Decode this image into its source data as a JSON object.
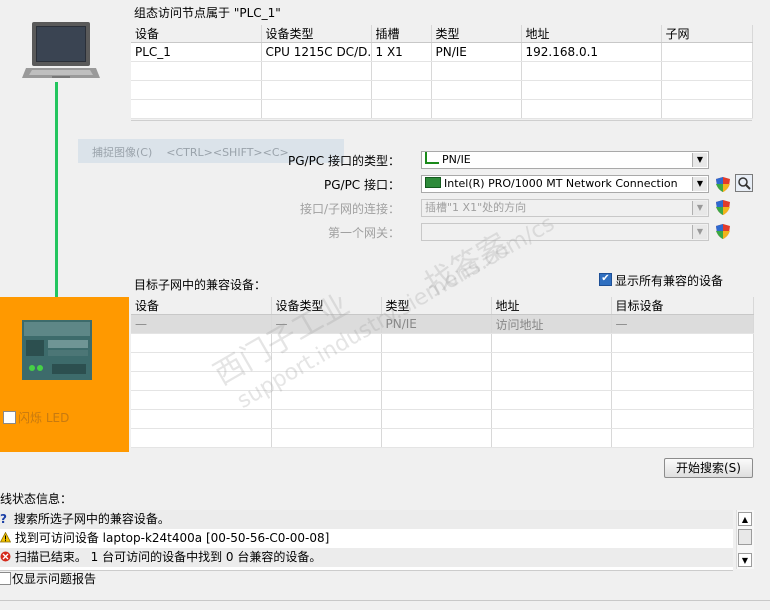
{
  "access_table": {
    "caption": "组态访问节点属于 \"PLC_1\"",
    "headers": [
      "设备",
      "设备类型",
      "插槽",
      "类型",
      "地址",
      "子网"
    ],
    "rows": [
      [
        "PLC_1",
        "CPU 1215C DC/D...",
        "1 X1",
        "PN/IE",
        "192.168.0.1",
        ""
      ],
      [
        "",
        "",
        "",
        "",
        "",
        ""
      ],
      [
        "",
        "",
        "",
        "",
        "",
        ""
      ],
      [
        "",
        "",
        "",
        "",
        "",
        ""
      ]
    ]
  },
  "capture_hint": "捕捉图像(C)    <CTRL><SHIFT><C>",
  "form": {
    "pgpc_type_label": "PG/PC 接口的类型：",
    "pgpc_type_value": "PN/IE",
    "pgpc_interface_label": "PG/PC 接口：",
    "pgpc_interface_value": "Intel(R) PRO/1000 MT Network Connection",
    "subnet_conn_label": "接口/子网的连接：",
    "subnet_conn_value": "插槽\"1 X1\"处的方向",
    "gateway_label": "第一个网关：",
    "gateway_value": ""
  },
  "compatible": {
    "caption": "目标子网中的兼容设备：",
    "show_all_label": "显示所有兼容的设备",
    "show_all_checked": true,
    "headers": [
      "设备",
      "设备类型",
      "类型",
      "地址",
      "目标设备"
    ],
    "rows": [
      [
        "—",
        "—",
        "PN/IE",
        "访问地址",
        "—"
      ],
      [
        "",
        "",
        "",
        "",
        ""
      ],
      [
        "",
        "",
        "",
        "",
        ""
      ],
      [
        "",
        "",
        "",
        "",
        ""
      ],
      [
        "",
        "",
        "",
        "",
        ""
      ],
      [
        "",
        "",
        "",
        "",
        ""
      ],
      [
        "",
        "",
        "",
        "",
        ""
      ]
    ]
  },
  "flash_led_label": "闪烁 LED",
  "start_search_label": "开始搜索(S)",
  "status": {
    "caption": "在线状态信息：",
    "messages": [
      {
        "icon": "question-icon",
        "text": "搜索所选子网中的兼容设备。"
      },
      {
        "icon": "warning-icon",
        "text": "找到可访问设备 laptop-k24t400a [00-50-56-C0-00-08]"
      },
      {
        "icon": "error-icon",
        "text": "扫描已结束。 1 台可访问的设备中找到 0 台兼容的设备。"
      }
    ],
    "only_problems_label": "仅显示问题报告"
  },
  "watermarks": [
    "西门子工业",
    "找答案",
    "support.industry.siemens.com/cs"
  ],
  "colors": {
    "link_line": "#22c55e",
    "target_panel": "#ff9900",
    "selected_row": "#dcdcdc"
  }
}
